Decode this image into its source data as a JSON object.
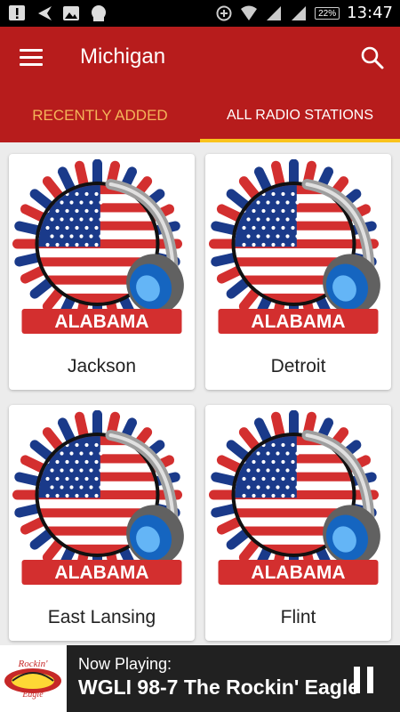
{
  "status_bar": {
    "time": "13:47",
    "battery": "22%"
  },
  "app_bar": {
    "title": "Michigan",
    "colors": {
      "primary": "#b71c1c",
      "indicator": "#f9c31c",
      "tab_inactive": "#f4b55a"
    }
  },
  "tabs": [
    {
      "label": "RECENTLY ADDED",
      "selected": false
    },
    {
      "label": "ALL RADIO STATIONS",
      "selected": true
    }
  ],
  "stations": [
    {
      "name": "Jackson",
      "banner": "ALABAMA"
    },
    {
      "name": "Detroit",
      "banner": "ALABAMA"
    },
    {
      "name": "East Lansing",
      "banner": "ALABAMA"
    },
    {
      "name": "Flint",
      "banner": "ALABAMA"
    }
  ],
  "now_playing": {
    "caption": "Now Playing:",
    "station": "WGLI 98-7 The Rockin' Eagle",
    "thumb_text": "Rockin' Eagle"
  }
}
